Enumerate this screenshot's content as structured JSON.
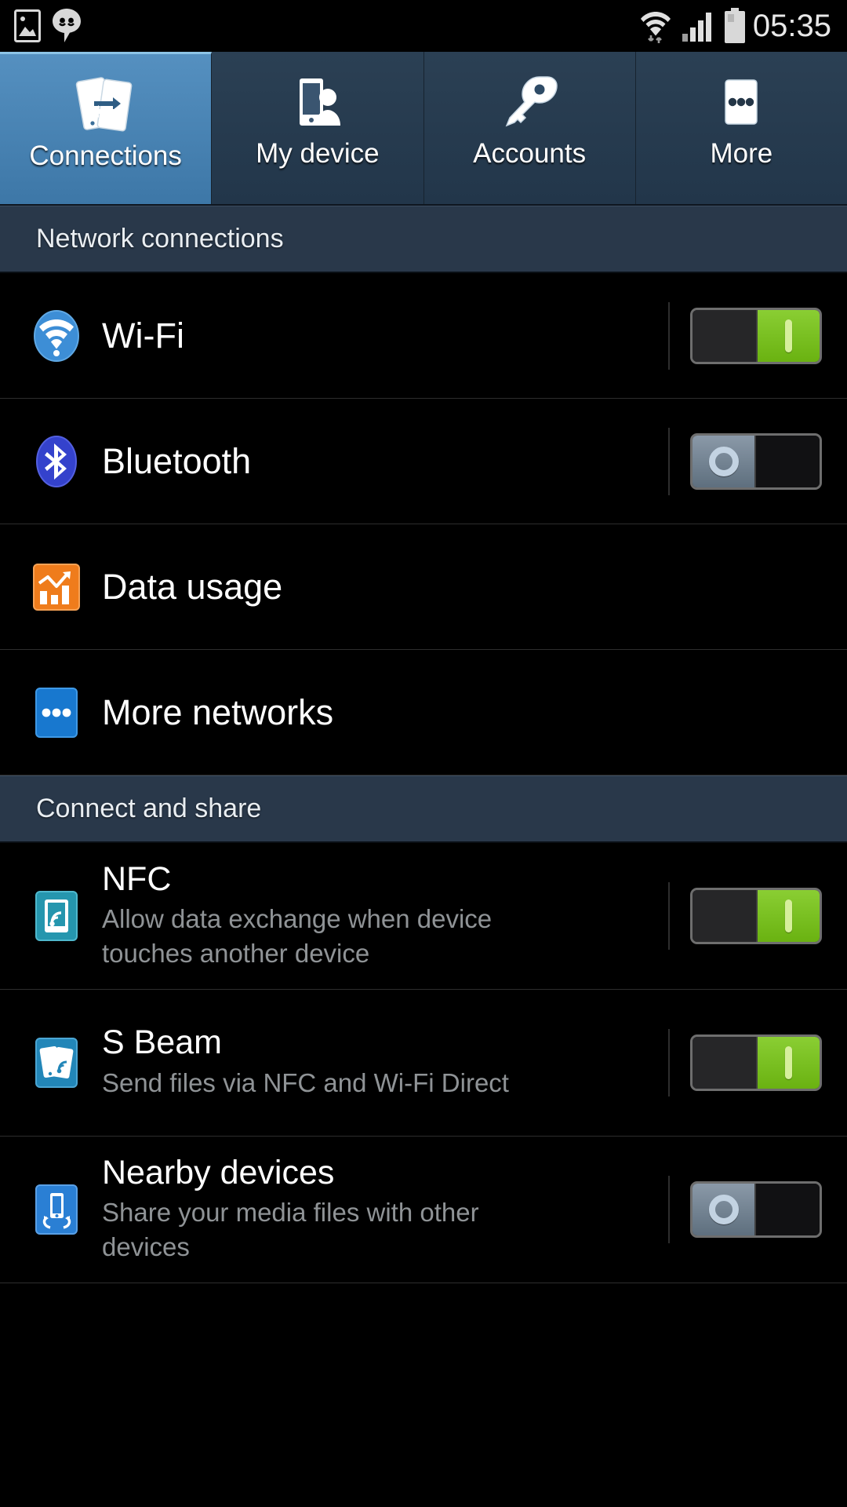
{
  "status_bar": {
    "time": "05:35",
    "left_icons": [
      {
        "name": "gallery-image-icon"
      },
      {
        "name": "hangouts-message-icon"
      }
    ],
    "right_icons": [
      {
        "name": "wifi-signal-icon"
      },
      {
        "name": "cellular-signal-icon"
      },
      {
        "name": "battery-icon"
      }
    ]
  },
  "tabs": [
    {
      "label": "Connections",
      "icon": "connections-icon",
      "active": true
    },
    {
      "label": "My device",
      "icon": "my-device-icon",
      "active": false
    },
    {
      "label": "Accounts",
      "icon": "accounts-key-icon",
      "active": false
    },
    {
      "label": "More",
      "icon": "more-dots-icon",
      "active": false
    }
  ],
  "sections": [
    {
      "title": "Network connections",
      "rows": [
        {
          "title": "Wi-Fi",
          "subtitle": "",
          "icon": "wifi-icon",
          "control": "toggle",
          "toggle_state": "on"
        },
        {
          "title": "Bluetooth",
          "subtitle": "",
          "icon": "bluetooth-icon",
          "control": "toggle",
          "toggle_state": "off"
        },
        {
          "title": "Data usage",
          "subtitle": "",
          "icon": "data-usage-icon",
          "control": "none",
          "toggle_state": ""
        },
        {
          "title": "More networks",
          "subtitle": "",
          "icon": "more-networks-icon",
          "control": "none",
          "toggle_state": ""
        }
      ]
    },
    {
      "title": "Connect and share",
      "rows": [
        {
          "title": "NFC",
          "subtitle": "Allow data exchange when device touches another device",
          "icon": "nfc-icon",
          "control": "toggle",
          "toggle_state": "on"
        },
        {
          "title": "S Beam",
          "subtitle": "Send files via NFC and Wi-Fi Direct",
          "icon": "s-beam-icon",
          "control": "toggle",
          "toggle_state": "on"
        },
        {
          "title": "Nearby devices",
          "subtitle": "Share your media files with other devices",
          "icon": "nearby-devices-icon",
          "control": "toggle",
          "toggle_state": "off"
        }
      ]
    }
  ],
  "colors": {
    "accent_tab_active": "#4a83b4",
    "header_bg": "#29384a",
    "toggle_on": "#76bd1d",
    "toggle_off_thumb": "#6f7f8e",
    "wifi_icon": "#3d8ed6",
    "bluetooth_icon": "#3442cc",
    "data_usage_icon": "#ef7c1c",
    "more_networks_icon": "#1878cf",
    "nfc_icon": "#2596ae",
    "s_beam_icon": "#2286b8",
    "nearby_devices_icon": "#2a7fd4",
    "row_background": "#000000",
    "title_text": "#ffffff",
    "subtitle_text": "#8f9396"
  }
}
